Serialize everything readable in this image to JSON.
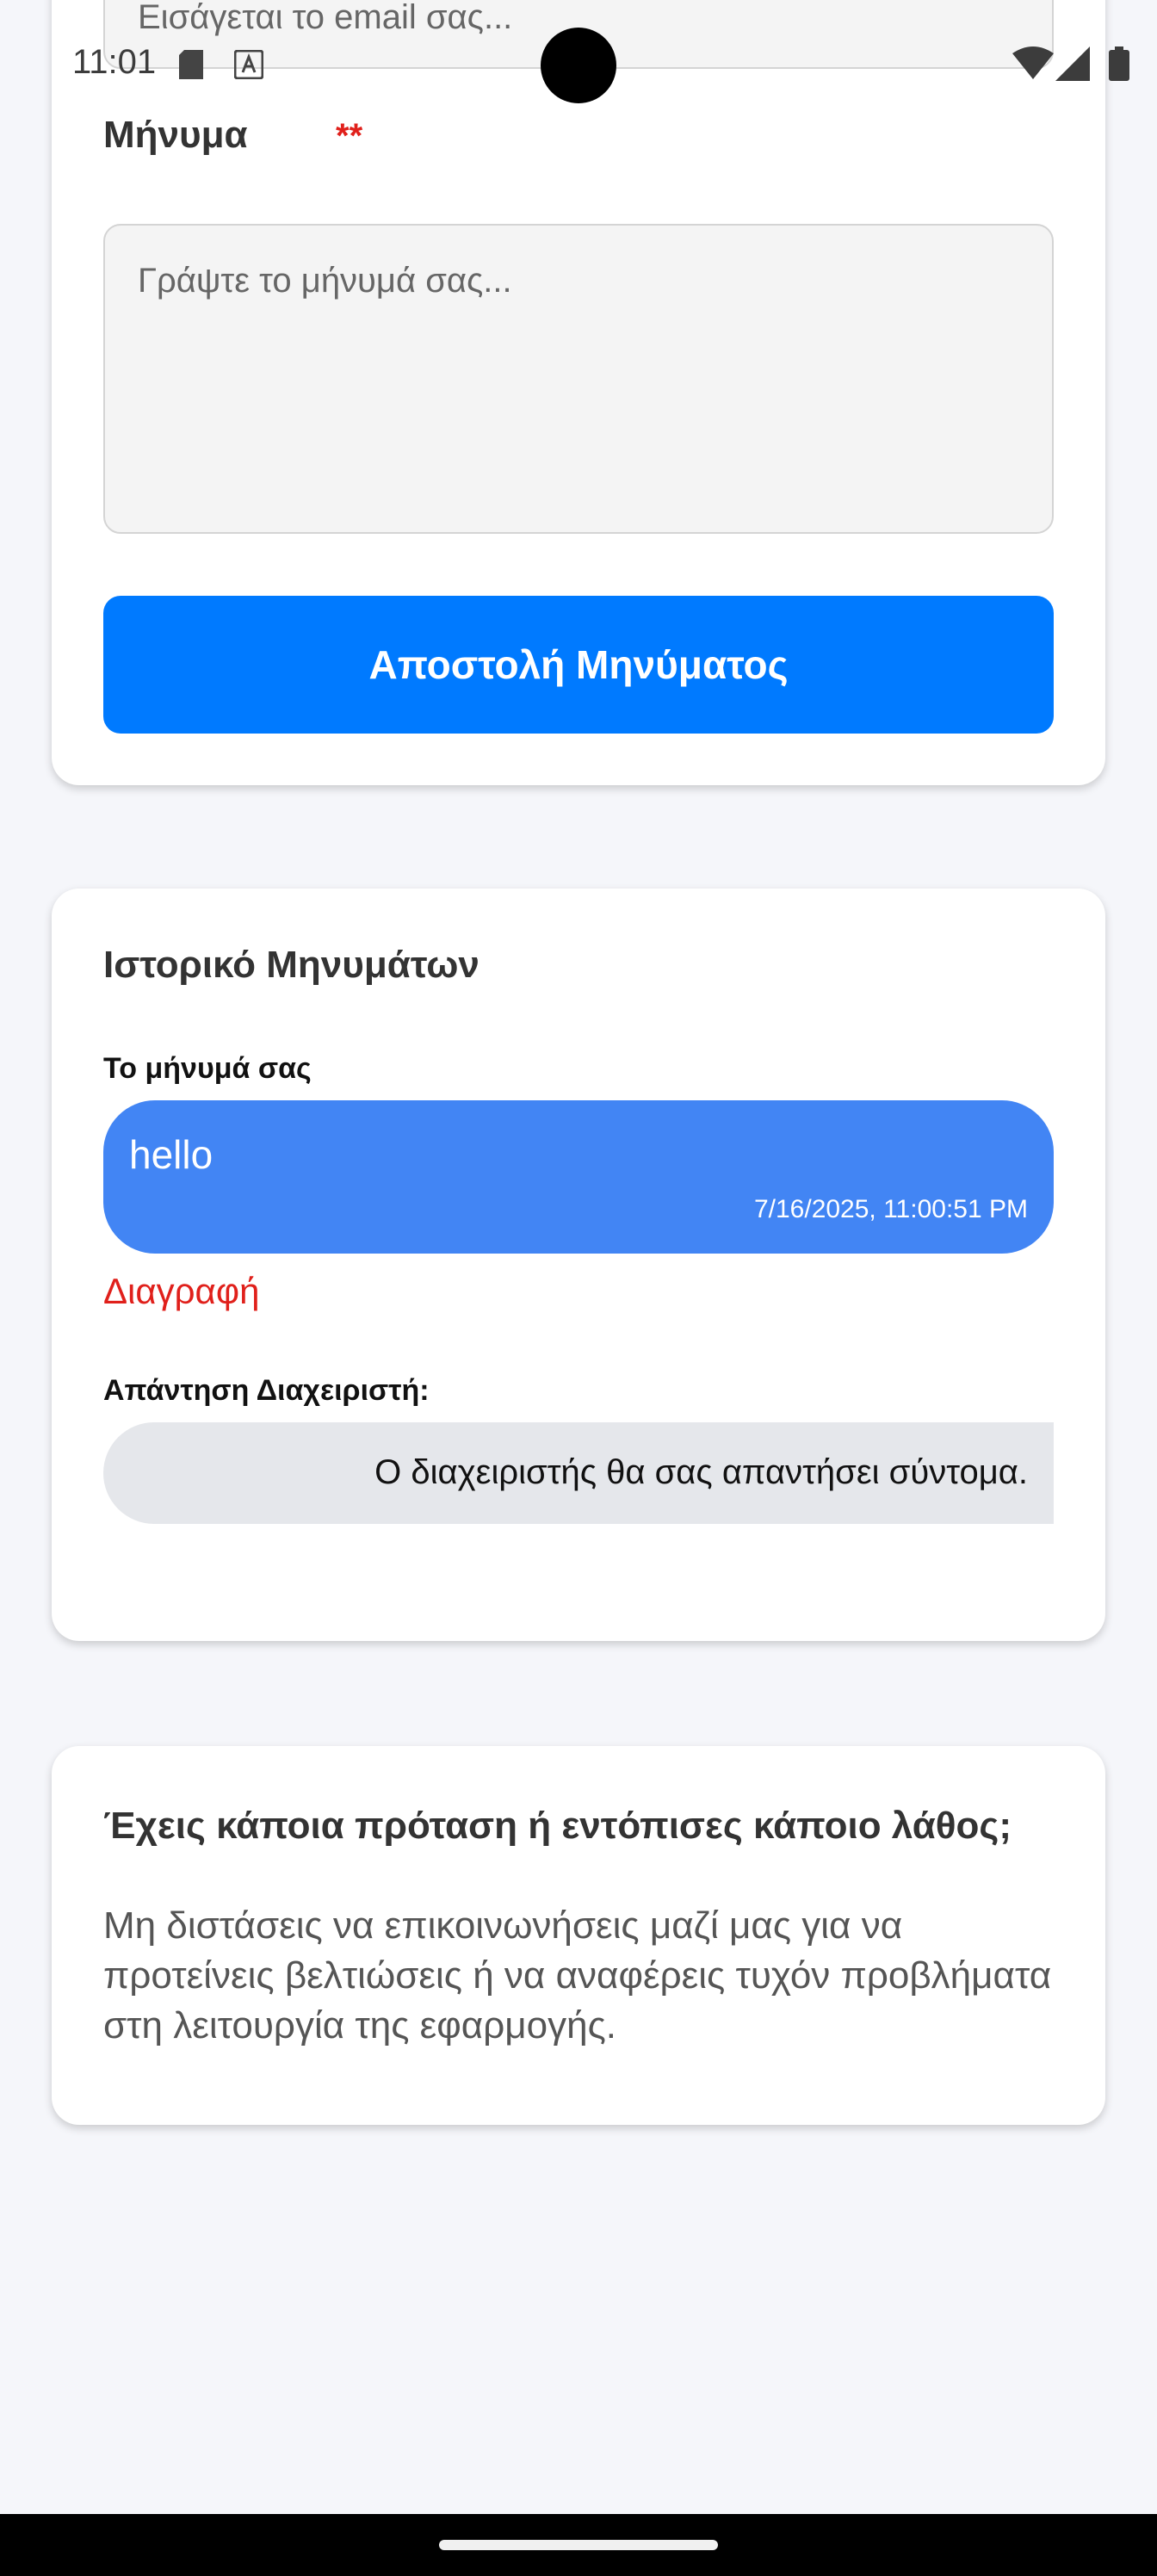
{
  "status_bar": {
    "time": "11:01",
    "icons": [
      "sd-card-icon",
      "translate-icon",
      "camera-hole",
      "wifi-icon",
      "signal-icon",
      "battery-icon"
    ]
  },
  "form": {
    "email_placeholder": "Εισάγεται το email σας...",
    "message_label": "Μήνυμα",
    "required_mark": "**",
    "message_placeholder": "Γράψτε το μήνυμά σας...",
    "send_button_label": "Αποστολή Μηνύματος"
  },
  "history": {
    "title": "Ιστορικό Μηνυμάτων",
    "user_caption": "Το μήνυμά σας",
    "user_message": "hello",
    "user_timestamp": "7/16/2025, 11:00:51 PM",
    "delete_label": "Διαγραφή",
    "admin_caption": "Απάντηση Διαχειριστή:",
    "admin_reply": "Ο διαχειριστής θα σας απαντήσει σύντομα."
  },
  "info": {
    "title": "Έχεις κάποια πρόταση ή εντόπισες κάποιο λάθος;",
    "body": "Μη διστάσεις να επικοινωνήσεις μαζί μας για να προτείνεις βελτιώσεις ή να αναφέρεις τυχόν προβλήματα στη λειτουργία της εφαρμογής."
  },
  "colors": {
    "primary": "#007aff",
    "user_bubble": "#4285f4",
    "admin_bubble": "#e5e7eb",
    "danger": "#e0201b",
    "background": "#f5f6fa"
  }
}
